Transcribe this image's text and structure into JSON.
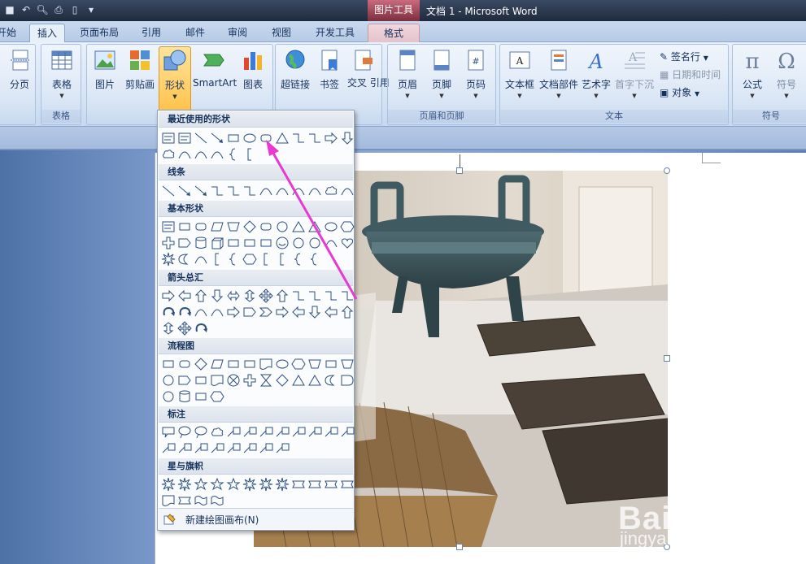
{
  "title_bar": {
    "context_tool": "图片工具",
    "window_title": "文档 1 - Microsoft Word"
  },
  "tabs": [
    {
      "label": "开始",
      "display": "开始"
    },
    {
      "label": "插入"
    },
    {
      "label": "页面布局"
    },
    {
      "label": "引用"
    },
    {
      "label": "邮件"
    },
    {
      "label": "审阅"
    },
    {
      "label": "视图"
    },
    {
      "label": "开发工具"
    },
    {
      "label": "格式"
    }
  ],
  "ribbon": {
    "groups": {
      "pages_label": "",
      "table_label": "表格",
      "illustrations_label": "",
      "links_label": "",
      "header_footer_label": "页眉和页脚",
      "text_label": "文本",
      "symbols_label": "符号"
    },
    "buttons": {
      "page_break": "分页",
      "table": "表格",
      "picture": "图片",
      "clipart": "剪贴画",
      "shapes": "形状",
      "smartart": "SmartArt",
      "chart": "图表",
      "hyperlink": "超链接",
      "bookmark": "书签",
      "cross_ref": "交叉\n引用",
      "header": "页眉",
      "footer": "页脚",
      "page_number": "页码",
      "textbox": "文本框",
      "quick_parts": "文档部件",
      "wordart": "艺术字",
      "dropcap": "首字下沉",
      "signature_line": "签名行",
      "date_time": "日期和时间",
      "object": "对象",
      "equation": "公式",
      "symbol": "符号"
    }
  },
  "shapes_menu": {
    "sections": [
      {
        "title": "最近使用的形状"
      },
      {
        "title": "线条"
      },
      {
        "title": "基本形状"
      },
      {
        "title": "箭头总汇"
      },
      {
        "title": "流程图"
      },
      {
        "title": "标注"
      },
      {
        "title": "星与旗帜"
      }
    ],
    "footer_label": "新建绘图画布(N)"
  },
  "watermark": {
    "brand": "Baidu经验",
    "url": "jingyan.baidu.com"
  },
  "colors": {
    "annotation_arrow": "#e83ad2",
    "accent_pressed": "#ffc34d"
  }
}
